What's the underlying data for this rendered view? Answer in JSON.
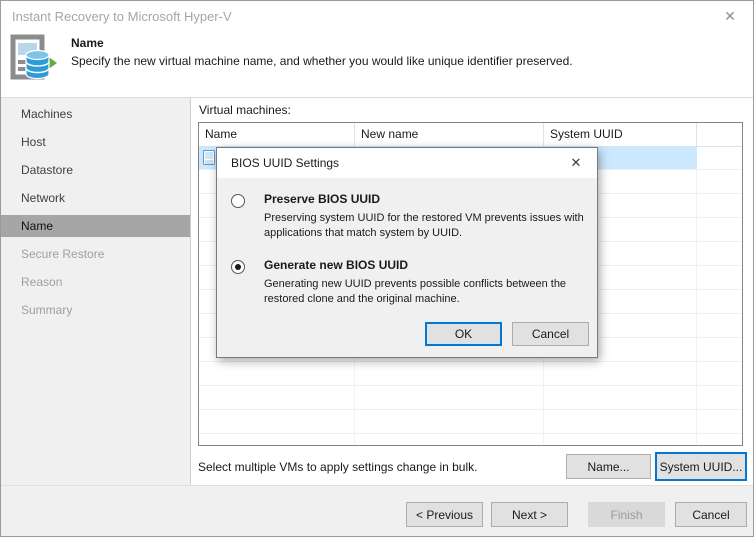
{
  "window": {
    "title": "Instant Recovery to Microsoft Hyper-V"
  },
  "icons": {
    "close_glyph": "✕"
  },
  "header": {
    "title": "Name",
    "description": "Specify the new virtual machine name, and whether you would like unique identifier preserved."
  },
  "sidebar": {
    "items": [
      {
        "label": "Machines",
        "state": "done"
      },
      {
        "label": "Host",
        "state": "done"
      },
      {
        "label": "Datastore",
        "state": "done"
      },
      {
        "label": "Network",
        "state": "done"
      },
      {
        "label": "Name",
        "state": "current"
      },
      {
        "label": "Secure Restore",
        "state": "upcoming"
      },
      {
        "label": "Reason",
        "state": "upcoming"
      },
      {
        "label": "Summary",
        "state": "upcoming"
      }
    ]
  },
  "main": {
    "vm_label": "Virtual machines:",
    "table": {
      "columns": [
        "Name",
        "New name",
        "System UUID"
      ],
      "visible_rows": 12,
      "selected_row": 0,
      "rows": [
        {
          "name": "",
          "new_name": "",
          "system_uuid": "",
          "selected": true
        }
      ]
    },
    "bulk_hint": "Select multiple VMs to apply settings change in bulk.",
    "name_button": "Name...",
    "uuid_button": "System UUID..."
  },
  "dialog": {
    "title": "BIOS UUID Settings",
    "options": [
      {
        "label": "Preserve BIOS UUID",
        "selected": false,
        "description_lines": [
          "Preserving system UUID for the restored VM prevents issues with",
          "applications that match system by UUID."
        ]
      },
      {
        "label": "Generate new BIOS UUID",
        "selected": true,
        "description_lines": [
          "Generating new UUID prevents possible conflicts between the",
          "restored clone and the original machine."
        ]
      }
    ],
    "ok_label": "OK",
    "cancel_label": "Cancel"
  },
  "footer": {
    "previous": "< Previous",
    "next": "Next >",
    "finish": "Finish",
    "cancel": "Cancel"
  },
  "colors": {
    "accent": "#0078d7",
    "selection": "#cce8ff",
    "sidebar_selected": "#a6a6a6"
  }
}
